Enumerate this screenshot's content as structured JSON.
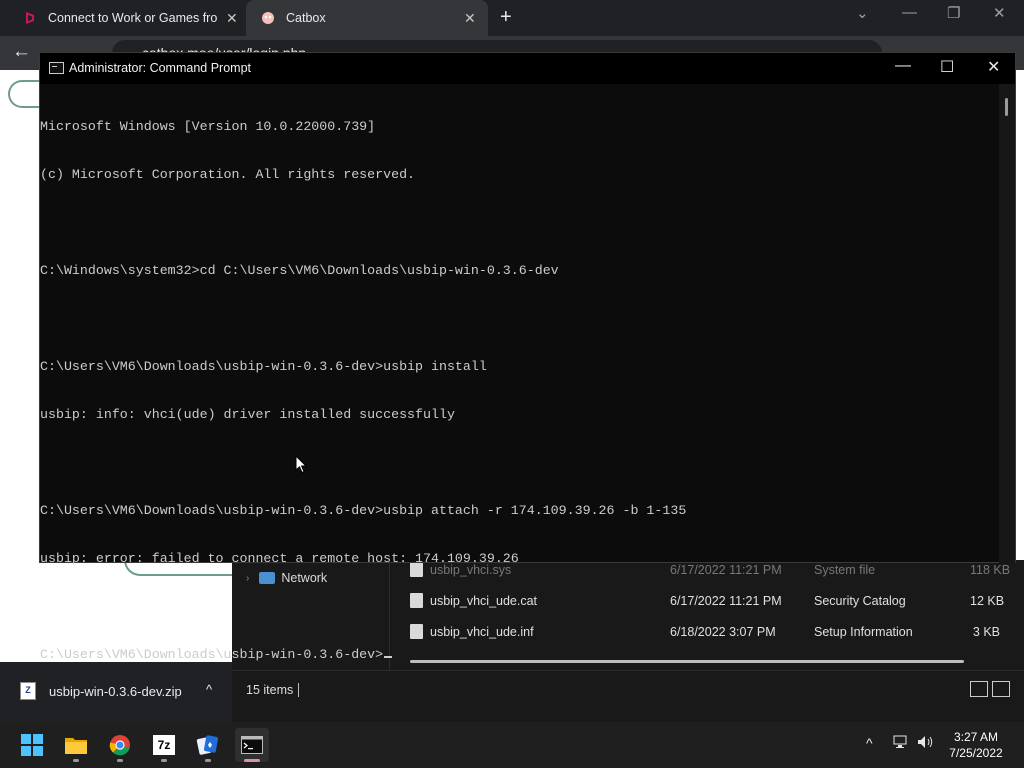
{
  "browser": {
    "tabs": [
      {
        "title": "Connect to Work or Games from",
        "close": "✕",
        "icon": "parsec-icon"
      },
      {
        "title": "Catbox",
        "close": "✕",
        "icon": "catbox-icon"
      }
    ],
    "new_tab": "+",
    "omnibox_text": "catbox.moe/user/login.php",
    "nav_back": "←",
    "window_controls": {
      "chevron": "⌄",
      "minimize": "—",
      "restore": "❐",
      "close": "✕"
    }
  },
  "downloads": {
    "file": "usbip-win-0.3.6-dev.zip",
    "icon_label": "Z",
    "chevron": "^"
  },
  "explorer": {
    "nav_item": "Network",
    "files": [
      {
        "name": "usbip_vhci.sys",
        "date": "6/17/2022 11:21 PM",
        "type": "System file",
        "size": "118 KB"
      },
      {
        "name": "usbip_vhci_ude.cat",
        "date": "6/17/2022 11:21 PM",
        "type": "Security Catalog",
        "size": "12 KB"
      },
      {
        "name": "usbip_vhci_ude.inf",
        "date": "6/18/2022 3:07 PM",
        "type": "Setup Information",
        "size": "3 KB"
      }
    ],
    "status": "15 items"
  },
  "cmd": {
    "title": "Administrator: Command Prompt",
    "controls": {
      "minimize": "—",
      "maximize": "☐",
      "close": "✕"
    },
    "lines": [
      "Microsoft Windows [Version 10.0.22000.739]",
      "(c) Microsoft Corporation. All rights reserved.",
      "",
      "C:\\Windows\\system32>cd C:\\Users\\VM6\\Downloads\\usbip-win-0.3.6-dev",
      "",
      "C:\\Users\\VM6\\Downloads\\usbip-win-0.3.6-dev>usbip install",
      "usbip: info: vhci(ude) driver installed successfully",
      "",
      "C:\\Users\\VM6\\Downloads\\usbip-win-0.3.6-dev>usbip attach -r 174.109.39.26 -b 1-135",
      "usbip: error: failed to connect a remote host: 174.109.39.26",
      "",
      "C:\\Users\\VM6\\Downloads\\usbip-win-0.3.6-dev>"
    ]
  },
  "taskbar": {
    "apps": [
      {
        "name": "start",
        "icon": "windows-logo-icon"
      },
      {
        "name": "file-explorer",
        "icon": "folder-icon"
      },
      {
        "name": "chrome",
        "icon": "chrome-icon"
      },
      {
        "name": "7-zip",
        "icon": "7zip-icon",
        "label": "7z"
      },
      {
        "name": "solitaire",
        "icon": "cards-icon"
      },
      {
        "name": "command-prompt",
        "icon": "terminal-icon",
        "active": true
      }
    ],
    "tray_chevron": "^",
    "clock_time": "3:27 AM",
    "clock_date": "7/25/2022"
  },
  "colors": {
    "cmd_bg": "#0c0c0c",
    "cmd_text": "#cccccc",
    "taskbar_bg": "#1f1f1f",
    "windows_blue": "#4cc2ff",
    "active_indicator": "#d890b5"
  }
}
